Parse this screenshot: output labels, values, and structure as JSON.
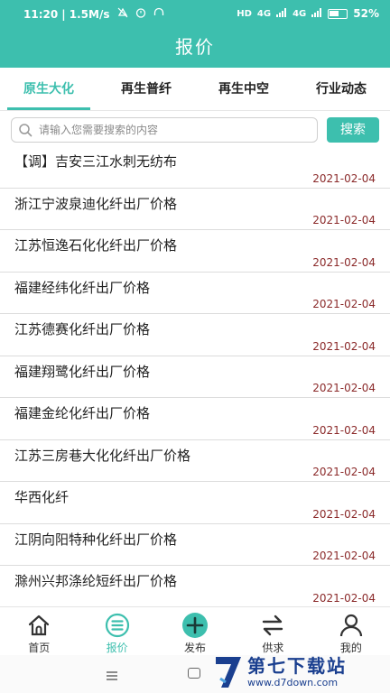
{
  "status": {
    "time": "11:20",
    "speed": "1.5M/s",
    "signal1": "4G",
    "signal2": "4G",
    "battery": "52"
  },
  "header": {
    "title": "报价"
  },
  "tabs": [
    {
      "label": "原生大化",
      "active": true
    },
    {
      "label": "再生普纤",
      "active": false
    },
    {
      "label": "再生中空",
      "active": false
    },
    {
      "label": "行业动态",
      "active": false
    }
  ],
  "search": {
    "placeholder": "请输入您需要搜索的内容",
    "button": "搜索"
  },
  "items": [
    {
      "title": "【调】吉安三江水刺无纺布",
      "date": "2021-02-04"
    },
    {
      "title": "浙江宁波泉迪化纤出厂价格",
      "date": "2021-02-04"
    },
    {
      "title": "江苏恒逸石化化纤出厂价格",
      "date": "2021-02-04"
    },
    {
      "title": "福建经纬化纤出厂价格",
      "date": "2021-02-04"
    },
    {
      "title": "江苏德赛化纤出厂价格",
      "date": "2021-02-04"
    },
    {
      "title": "福建翔鹭化纤出厂价格",
      "date": "2021-02-04"
    },
    {
      "title": "福建金纶化纤出厂价格",
      "date": "2021-02-04"
    },
    {
      "title": "江苏三房巷大化化纤出厂价格",
      "date": "2021-02-04"
    },
    {
      "title": "华西化纤",
      "date": "2021-02-04"
    },
    {
      "title": "江阴向阳特种化纤出厂价格",
      "date": "2021-02-04"
    },
    {
      "title": "滁州兴邦涤纶短纤出厂价格",
      "date": "2021-02-04"
    }
  ],
  "nav": [
    {
      "label": "首页",
      "icon": "home-icon"
    },
    {
      "label": "报价",
      "icon": "list-icon",
      "active": true
    },
    {
      "label": "发布",
      "icon": "plus-icon"
    },
    {
      "label": "供求",
      "icon": "swap-icon"
    },
    {
      "label": "我的",
      "icon": "user-icon"
    }
  ],
  "watermark": {
    "name": "第七下载站",
    "url": "www.d7down.com"
  },
  "colors": {
    "accent": "#3dbfae",
    "date": "#8b2a2a"
  }
}
